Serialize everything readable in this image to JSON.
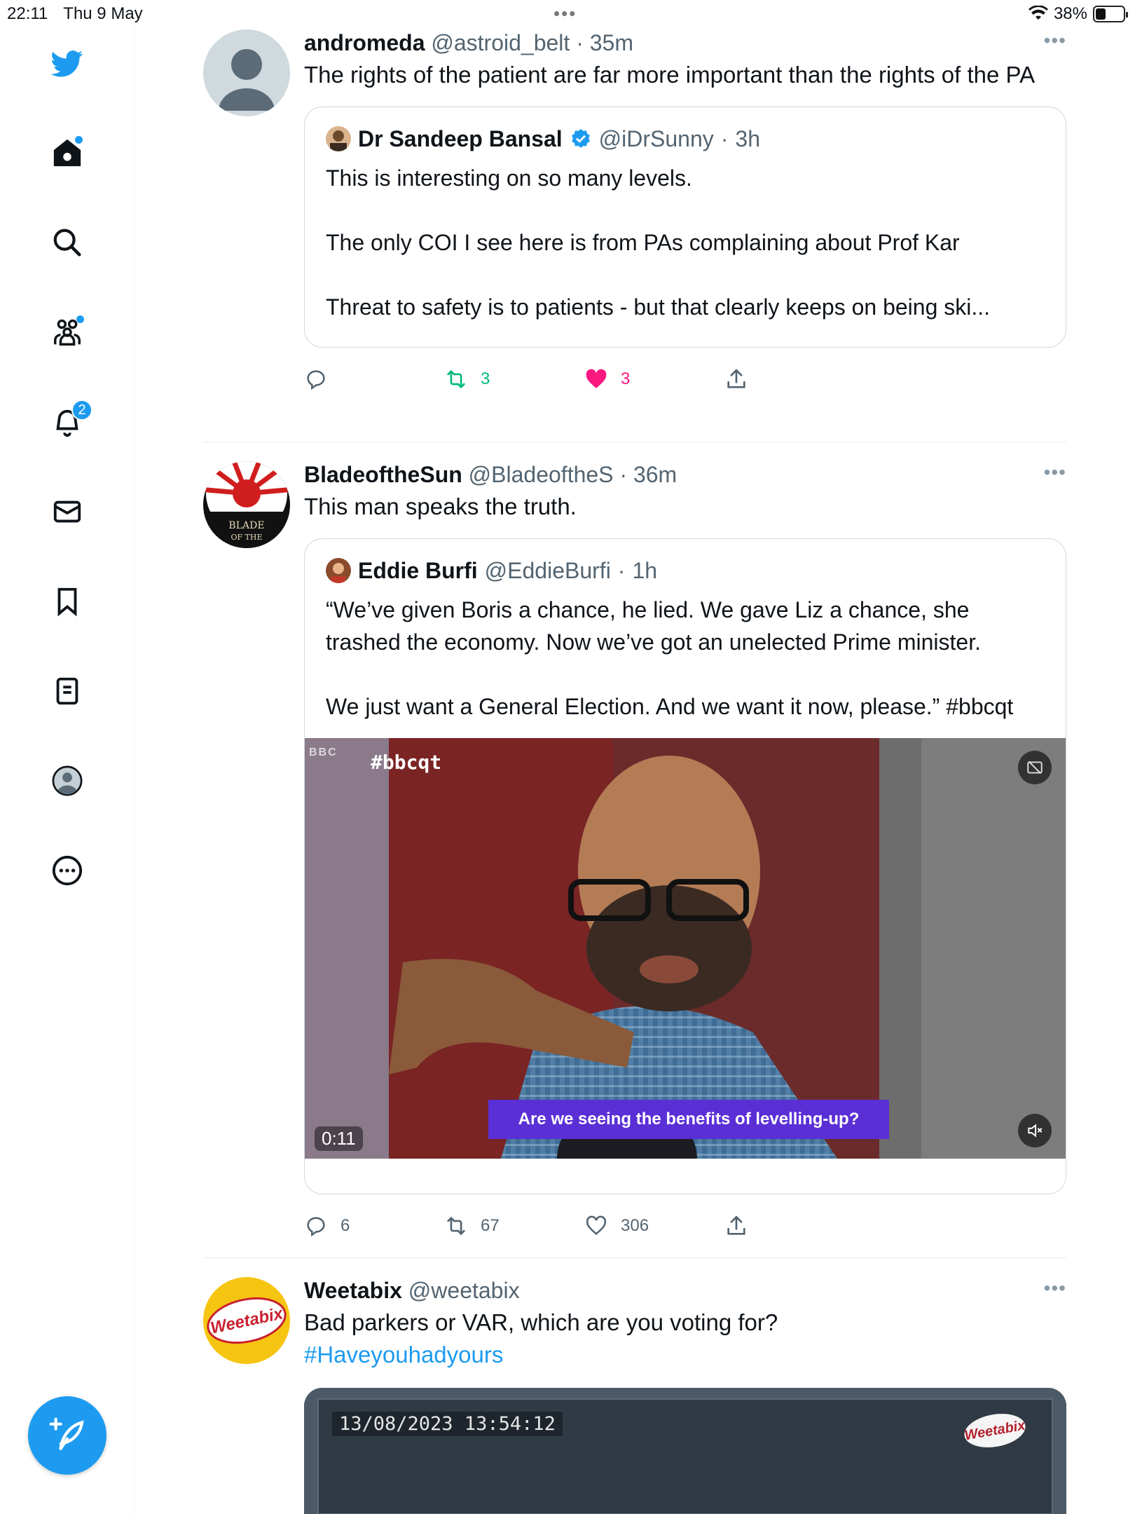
{
  "status_bar": {
    "time": "22:11",
    "date": "Thu 9 May",
    "dots": "•••",
    "battery": "38%",
    "battery_level": 0.38
  },
  "sidebar": {
    "notifications_badge": "2",
    "icons": [
      "twitter-logo",
      "home-icon",
      "search-icon",
      "communities-icon",
      "notifications-icon",
      "messages-icon",
      "bookmark-icon",
      "lists-icon",
      "profile-icon",
      "more-icon"
    ],
    "accent": "#1d9bf0"
  },
  "tweets": [
    {
      "name": "andromeda",
      "handle": "@astroid_belt",
      "time": "35m",
      "text": "The rights of the patient are far more important than the rights of the PA",
      "more": "•••",
      "quote": {
        "name": "Dr Sandeep Bansal",
        "handle": "@iDrSunny",
        "time": "3h",
        "lines": [
          "This is interesting on so many levels.",
          "",
          "The only COI I see here is from PAs complaining about Prof Kar",
          "",
          "Threat to safety is to patients - but that clearly keeps on being ski..."
        ]
      },
      "actions": {
        "replies": "",
        "retweets": "3",
        "likes": "3"
      }
    },
    {
      "name": "BladeoftheSun",
      "handle": "@BladeoftheS",
      "time": "36m",
      "text": "This man speaks the truth.",
      "more": "•••",
      "avatar_text": "BLADE OF THE",
      "quote": {
        "name": "Eddie Burfi",
        "handle": "@EddieBurfi",
        "time": "1h",
        "lines": [
          "“We’ve given Boris a chance, he lied. We gave Liz a chance, she trashed the economy. Now we’ve got an unelected Prime minister.",
          "",
          "We just want a General Election. And we want it now, please.” #bbcqt"
        ],
        "media": {
          "tag": "#bbcqt",
          "bbc": "BBC",
          "caption": "Are we seeing the benefits of levelling-up?",
          "duration": "0:11"
        }
      },
      "actions": {
        "replies": "6",
        "retweets": "67",
        "likes": "306"
      }
    },
    {
      "name": "Weetabix",
      "handle": "@weetabix",
      "time": "",
      "text": "Bad parkers or VAR, which are you voting for?",
      "hashtag": "#Haveyouhadyours",
      "more": "•••",
      "avatar_text": "Weetabix",
      "media": {
        "timestamp": "13/08/2023  13:54:12",
        "logo": "Weetabix"
      }
    }
  ]
}
